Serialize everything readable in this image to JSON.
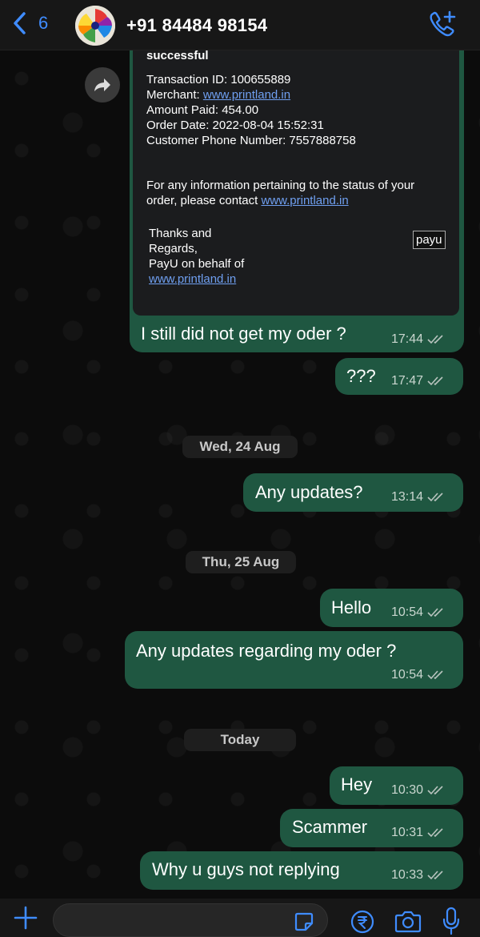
{
  "header": {
    "back_count": "6",
    "contact_name": "+91 84484 98154"
  },
  "card": {
    "partial_line": "successful",
    "transaction_id": "Transaction ID: 100655889",
    "merchant_label": "Merchant: ",
    "merchant_link": "www.printland.in",
    "amount_paid": "Amount Paid: 454.00",
    "order_date": "Order Date: 2022-08-04 15:52:31",
    "customer_phone": "Customer Phone Number: 7557888758",
    "info_line1": "For any information pertaining to the status of your",
    "info_line2_prefix": "order, please contact ",
    "info_link": "www.printland.in",
    "thanks": "Thanks and",
    "regards": "Regards,",
    "payu_behalf": "PayU on behalf of",
    "footer_link": "www.printland.in",
    "payu_logo": "payu"
  },
  "messages": [
    {
      "text": "I still did not get my oder ?",
      "time": "17:44"
    },
    {
      "text": "???",
      "time": "17:47"
    },
    {
      "text": "Any updates?",
      "time": "13:14"
    },
    {
      "text": "Hello",
      "time": "10:54"
    },
    {
      "text": "Any updates regarding my oder ?",
      "time": "10:54"
    },
    {
      "text": "Hey",
      "time": "10:30"
    },
    {
      "text": "Scammer",
      "time": "10:31"
    },
    {
      "text": "Why u guys not replying",
      "time": "10:33"
    }
  ],
  "dates": {
    "wed": "Wed, 24 Aug",
    "thu": "Thu, 25 Aug",
    "today": "Today"
  },
  "icons": {
    "back": "chevron-left-icon",
    "call": "phone-plus-icon",
    "forward": "forward-arrow-icon",
    "read": "double-check-icon",
    "attach": "plus-icon",
    "sticker": "sticker-icon",
    "payment": "rupee-icon",
    "camera": "camera-icon",
    "mic": "microphone-icon"
  },
  "colors": {
    "accent": "#3f8cff",
    "bubble": "#1f5741",
    "background": "#0c0c0c"
  }
}
